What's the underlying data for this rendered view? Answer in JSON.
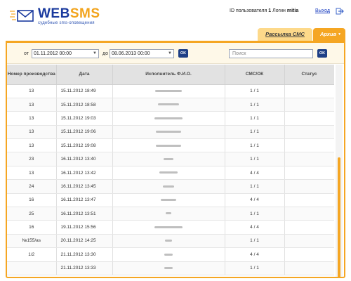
{
  "header": {
    "logo_web": "WEB",
    "logo_sms": "SMS",
    "tagline": "судебные sms-оповещения",
    "user_id_label": "ID пользователя",
    "user_id_value": "1",
    "login_label": "Логин",
    "login_value": "mitia",
    "logout_label": "Выход"
  },
  "tabs": [
    {
      "label": "Рассылка СМС",
      "active": false
    },
    {
      "label": "Архив",
      "active": true
    }
  ],
  "filter": {
    "from_label": "от",
    "from_value": "01.11.2012 00:00",
    "to_label": "до",
    "to_value": "08.06.2013 00:00",
    "ok_label": "OK",
    "search_placeholder": "Поиск",
    "search_ok_label": "OK"
  },
  "table": {
    "columns": [
      "Номер производства",
      "Дата",
      "Исполнитель Ф.И.О.",
      "СМС/ОК",
      "Статус"
    ],
    "rows": [
      {
        "case": "13",
        "date": "15.11.2012 18:49",
        "sms": "1 / 1",
        "status": ""
      },
      {
        "case": "13",
        "date": "15.11.2012 18:58",
        "sms": "1 / 1",
        "status": ""
      },
      {
        "case": "13",
        "date": "15.11.2012 19:03",
        "sms": "1 / 1",
        "status": ""
      },
      {
        "case": "13",
        "date": "15.11.2012 19:06",
        "sms": "1 / 1",
        "status": ""
      },
      {
        "case": "13",
        "date": "15.11.2012 19:08",
        "sms": "1 / 1",
        "status": ""
      },
      {
        "case": "23",
        "date": "16.11.2012 13:40",
        "sms": "1 / 1",
        "status": ""
      },
      {
        "case": "13",
        "date": "16.11.2012 13:42",
        "sms": "4 / 4",
        "status": ""
      },
      {
        "case": "24",
        "date": "16.11.2012 13:45",
        "sms": "1 / 1",
        "status": ""
      },
      {
        "case": "16",
        "date": "16.11.2012 13:47",
        "sms": "4 / 4",
        "status": ""
      },
      {
        "case": "25",
        "date": "16.11.2012 13:51",
        "sms": "1 / 1",
        "status": ""
      },
      {
        "case": "16",
        "date": "19.11.2012 15:56",
        "sms": "4 / 4",
        "status": ""
      },
      {
        "case": "№155/as",
        "date": "20.11.2012 14:25",
        "sms": "1 / 1",
        "status": ""
      },
      {
        "case": "1/2",
        "date": "21.11.2012 13:30",
        "sms": "4 / 4",
        "status": ""
      },
      {
        "case": "",
        "date": "21.11.2012 13:33",
        "sms": "1 / 1",
        "status": ""
      }
    ]
  },
  "colors": {
    "accent": "#f5a623",
    "brand_blue": "#1a3a9e",
    "button": "#1e3f86"
  },
  "icons": [
    "envelope-logo-icon",
    "logout-arrow-icon",
    "dropdown-icon"
  ]
}
